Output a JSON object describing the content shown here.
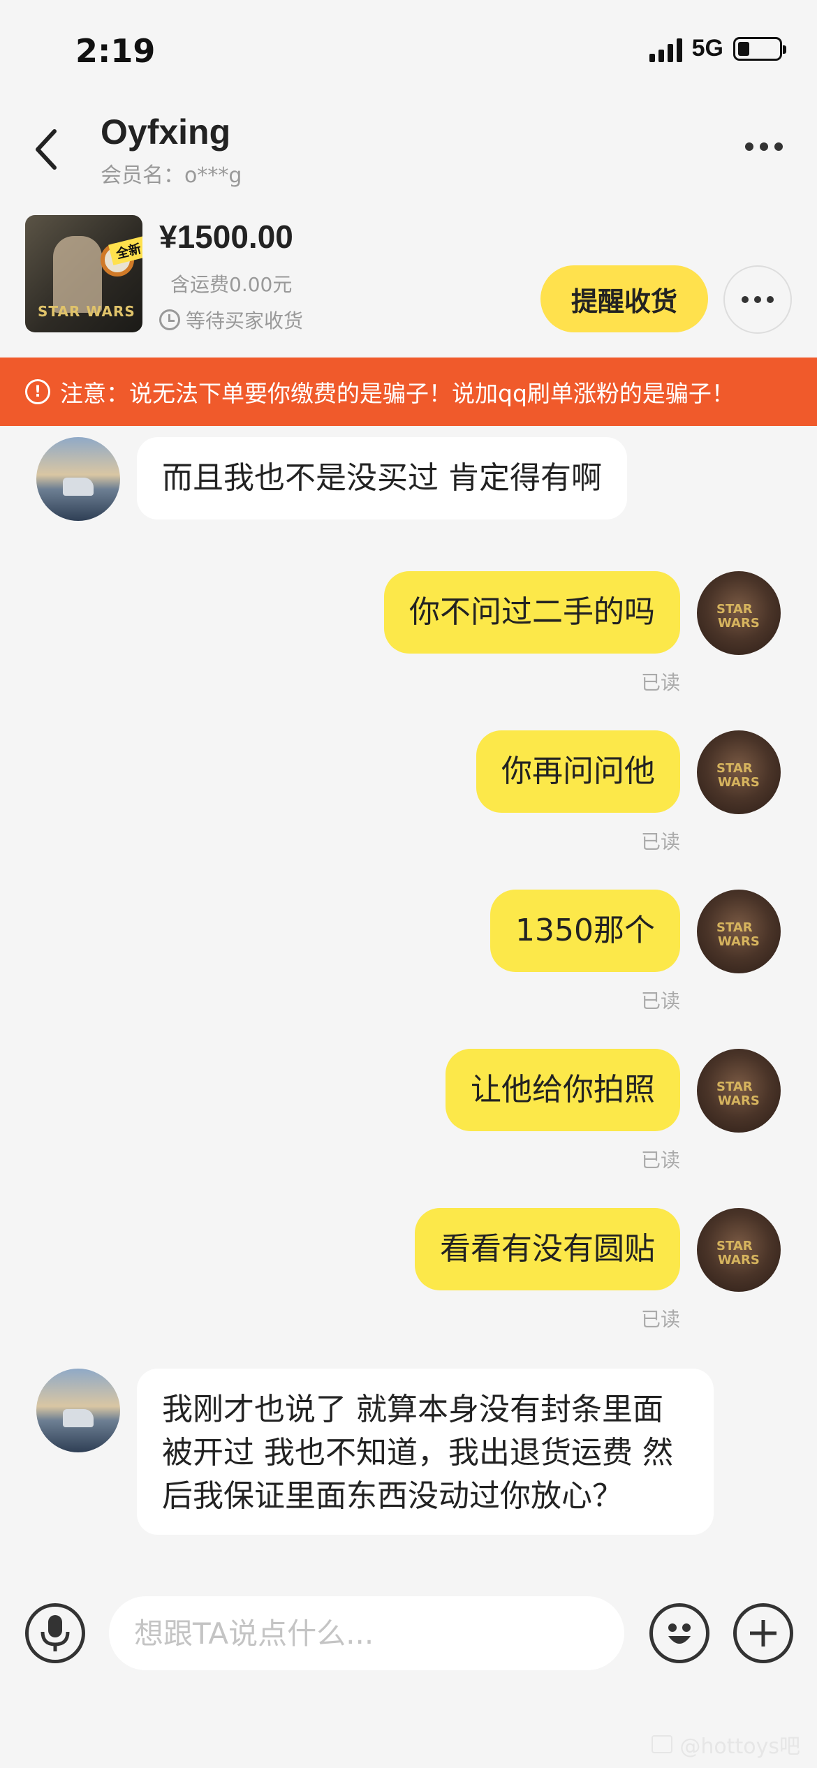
{
  "status_bar": {
    "time": "2:19",
    "network": "5G",
    "battery_level": 0.25
  },
  "header": {
    "user_name": "Oyfxing",
    "member_label": "会员名：o***g",
    "back_icon": "chevron-left-icon",
    "more_icon": "more-horizontal-icon"
  },
  "product": {
    "price": "¥1500.00",
    "shipping": "含运费0.00元",
    "status": "等待买家收货",
    "remind_label": "提醒收货",
    "thumb_tag": "全新",
    "thumb_logo": "STAR WARS"
  },
  "warning": {
    "icon": "alert-circle-icon",
    "text": "注意：说无法下单要你缴费的是骗子！说加qq刷单涨粉的是骗子！",
    "color": "#f05a2b"
  },
  "messages": [
    {
      "from": "them",
      "text": "而且我也不是没买过  肯定得有啊"
    },
    {
      "from": "me",
      "text": "你不问过二手的吗",
      "status": "已读"
    },
    {
      "from": "me",
      "text": "你再问问他",
      "status": "已读"
    },
    {
      "from": "me",
      "text": "1350那个",
      "status": "已读"
    },
    {
      "from": "me",
      "text": "让他给你拍照",
      "status": "已读"
    },
    {
      "from": "me",
      "text": "看看有没有圆贴",
      "status": "已读"
    },
    {
      "from": "them",
      "text": "我刚才也说了   就算本身没有封条里面被开过  我也不知道，我出退货运费 然后我保证里面东西没动过你放心？"
    }
  ],
  "input": {
    "placeholder": "想跟TA说点什么...",
    "mic_icon": "microphone-icon",
    "emoji_icon": "emoji-icon",
    "add_icon": "plus-icon"
  },
  "colors": {
    "accent_yellow": "#ffe14d",
    "bubble_mine": "#fce84a",
    "warning_bg": "#f05a2b",
    "background": "#f5f5f5"
  },
  "watermark": "@hottoys吧"
}
